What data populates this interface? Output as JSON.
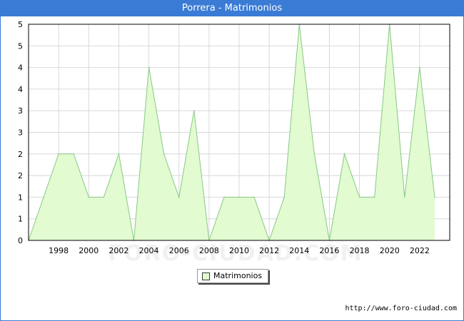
{
  "header": {
    "title": "Porrera - Matrimonios"
  },
  "footer": {
    "url": "http://www.foro-ciudad.com"
  },
  "watermark": {
    "text": "FORO-CIUDAD.COM"
  },
  "colors": {
    "title_bar": "#3a7bd5",
    "area_fill": "#e2fbd0",
    "area_stroke": "#86c986",
    "grid": "#d8d8d8"
  },
  "chart_data": {
    "type": "area",
    "title": "Porrera - Matrimonios",
    "xlabel": "",
    "ylabel": "",
    "x": [
      1996,
      1997,
      1998,
      1999,
      2000,
      2001,
      2002,
      2003,
      2004,
      2005,
      2006,
      2007,
      2008,
      2009,
      2010,
      2011,
      2012,
      2013,
      2014,
      2015,
      2016,
      2017,
      2018,
      2019,
      2020,
      2021,
      2022,
      2023
    ],
    "series": [
      {
        "name": "Matrimonios",
        "values": [
          0,
          1,
          2,
          2,
          1,
          1,
          2,
          0,
          4,
          2,
          1,
          3,
          0,
          1,
          1,
          1,
          0,
          1,
          5,
          2,
          0,
          2,
          1,
          1,
          5,
          1,
          4,
          1
        ]
      }
    ],
    "xticks": [
      "1998",
      "2000",
      "2002",
      "2004",
      "2006",
      "2008",
      "2010",
      "2012",
      "2014",
      "2016",
      "2018",
      "2020",
      "2022"
    ],
    "yticks": [
      "0",
      "1",
      "1",
      "2",
      "2",
      "3",
      "3",
      "4",
      "4",
      "5",
      "5"
    ],
    "xlim": [
      1996,
      2024
    ],
    "ylim": [
      0,
      5
    ],
    "grid": true,
    "legend_position": "bottom-center"
  }
}
